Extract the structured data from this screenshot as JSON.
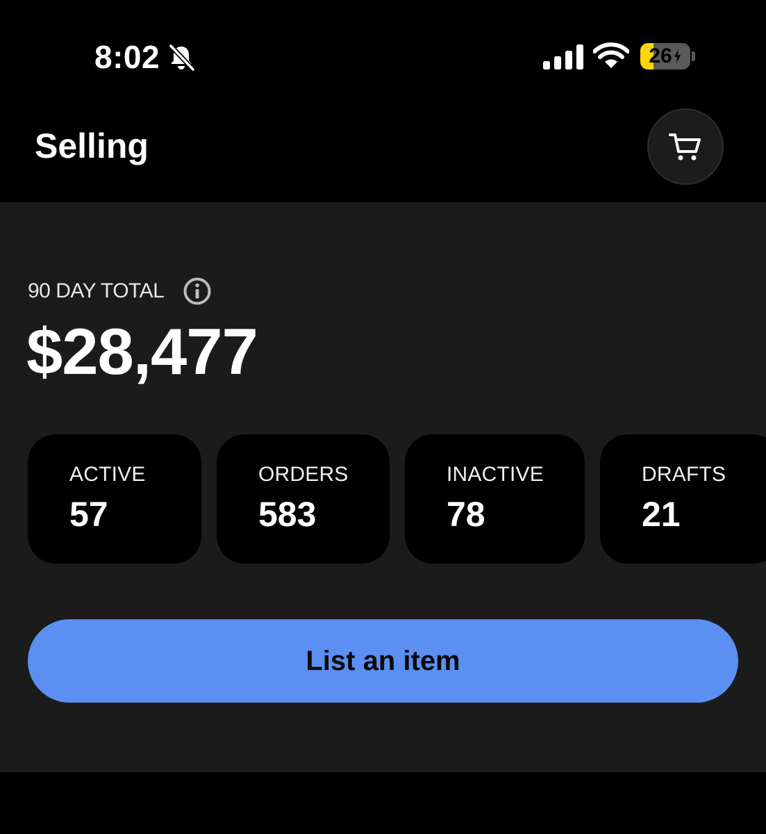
{
  "status_bar": {
    "time": "8:02",
    "battery_level": "26",
    "battery_fraction": 0.26,
    "battery_color": "#ffd60a",
    "icons": [
      "bell-slash-icon",
      "cellular-signal-icon",
      "wifi-icon",
      "battery-charging-icon"
    ]
  },
  "header": {
    "title": "Selling",
    "cart_icon": "cart-icon"
  },
  "summary": {
    "total_label": "90 DAY TOTAL",
    "info_icon": "info-icon",
    "total_value": "$28,477"
  },
  "stats": [
    {
      "label": "ACTIVE",
      "value": "57"
    },
    {
      "label": "ORDERS",
      "value": "583"
    },
    {
      "label": "INACTIVE",
      "value": "78"
    },
    {
      "label": "DRAFTS",
      "value": "21"
    }
  ],
  "actions": {
    "list_item_label": "List an item",
    "accent_color": "#5b8ff2"
  }
}
